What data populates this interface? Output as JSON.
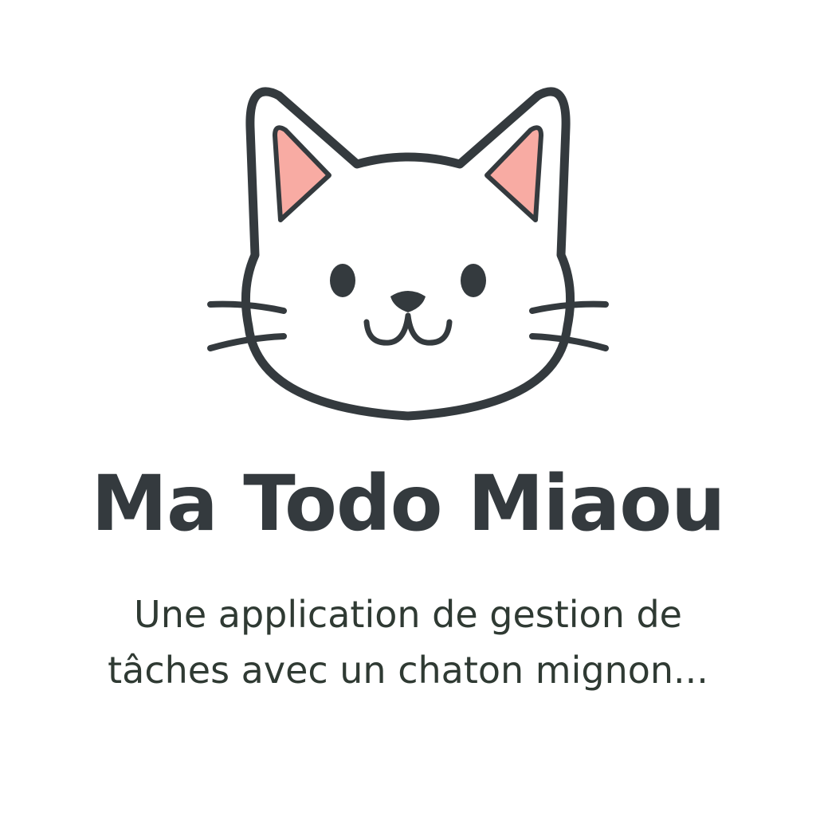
{
  "app": {
    "title": "Ma Todo Miaou",
    "tagline": "Une application de gestion de tâches avec un chaton mignon..."
  },
  "logo": {
    "icon": "cat-face-icon",
    "colors": {
      "outline": "#343a3e",
      "inner_ear": "#f8aba3",
      "face": "#ffffff"
    }
  },
  "colors": {
    "background": "#ffffff",
    "title": "#343a3e",
    "tagline": "#2f3a33"
  }
}
